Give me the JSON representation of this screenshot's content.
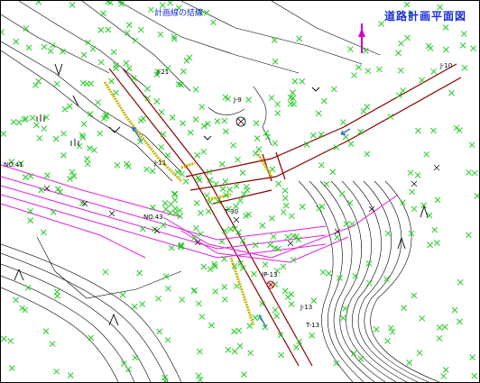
{
  "title": "道路計画平面図",
  "subtitle": "計画線の結線",
  "labels": {
    "j21": "J-21",
    "j9": "J-9",
    "j10": "J-10",
    "j11": "J-11",
    "t30": "T-30",
    "no41": "NO.41",
    "no43": "NO.43",
    "ip13": "IP-13",
    "j13": "J-13",
    "t13": "T-13"
  },
  "colors": {
    "road": "#8b0000",
    "plan": "#e020e0",
    "points": "#22cc22",
    "terrain": "#000000",
    "title": "#1a2fd8"
  }
}
